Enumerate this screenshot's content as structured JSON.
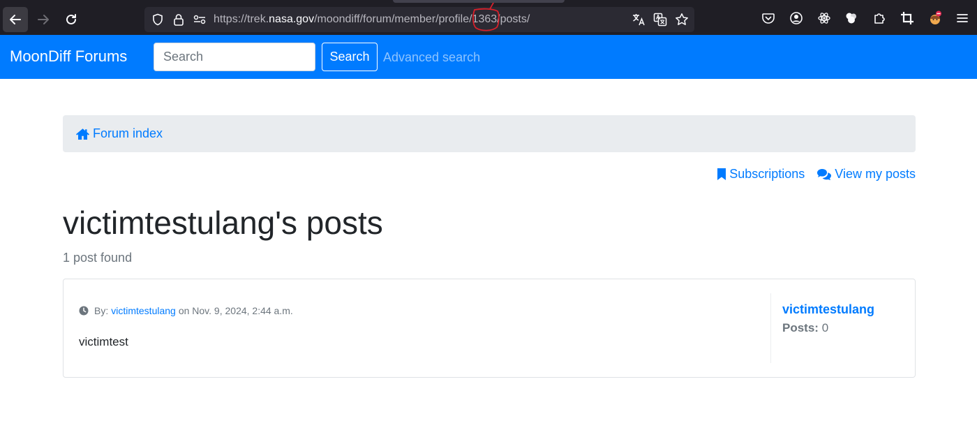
{
  "browser": {
    "url_scheme": "https://trek.",
    "url_host": "nasa.gov",
    "url_path": "/moondiff/forum/member/profile/1363/posts/",
    "nav_icons": [
      "back-arrow-icon",
      "forward-arrow-icon",
      "reload-icon"
    ],
    "url_icons": [
      "shield-icon",
      "lock-icon",
      "permissions-icon"
    ],
    "url_actions": [
      "translate-icon",
      "page-translate-icon",
      "bookmark-star-icon"
    ],
    "toolbar_icons": [
      "pocket-icon",
      "account-icon",
      "react-devtools-icon",
      "extension-icon",
      "extensions-puzzle-icon",
      "crop-icon",
      "avatar-extension-icon",
      "menu-icon"
    ],
    "annotation_color": "#d9202b"
  },
  "site": {
    "brand": "MoonDiff Forums",
    "search_placeholder": "Search",
    "search_button": "Search",
    "advanced_search": "Advanced search",
    "accent_color": "#007bff"
  },
  "breadcrumb": {
    "label": "Forum index",
    "icon": "home-icon"
  },
  "user_links": {
    "subscriptions": "Subscriptions",
    "subscriptions_icon": "bookmark-icon",
    "my_posts": "View my posts",
    "my_posts_icon": "comments-icon"
  },
  "page": {
    "title": "victimtestulang's posts",
    "count": "1 post found"
  },
  "post": {
    "by_label": "By:",
    "author": "victimtestulang",
    "date": "on Nov. 9, 2024, 2:44 a.m.",
    "body": "victimtest",
    "meta_icon": "clock-icon"
  },
  "author_card": {
    "name": "victimtestulang",
    "posts_label": "Posts:",
    "posts_value": "0"
  }
}
